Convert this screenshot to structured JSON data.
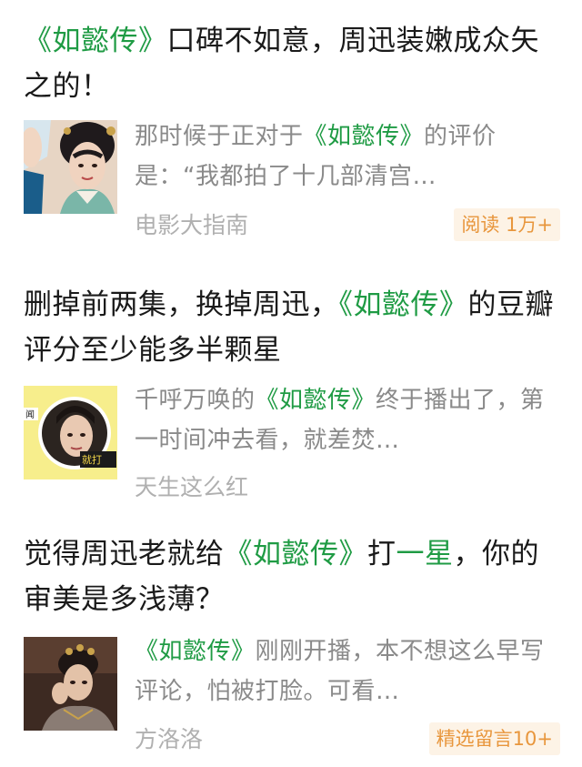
{
  "articles": [
    {
      "title": {
        "pre": "",
        "hl1": "《如懿传》",
        "mid": "口碑不如意，周迅装嫩成众矢之的！",
        "hl2": "",
        "post": ""
      },
      "summary": {
        "pre": "那时候于正对于",
        "hl": "《如懿传》",
        "post": "的评价是：“我都拍了十几部清宫…"
      },
      "source": "电影大指南",
      "badge": "阅读 1万+"
    },
    {
      "title": {
        "pre": "删掉前两集，换掉周迅，",
        "hl1": "《如懿传》",
        "mid": "的豆瓣评分至少能多半颗星",
        "hl2": "",
        "post": ""
      },
      "summary": {
        "pre": "千呼万唤的",
        "hl": "《如懿传》",
        "post": "终于播出了，第一时间冲去看，就差焚…"
      },
      "source": "天生这么红",
      "badge": ""
    },
    {
      "title": {
        "pre": "觉得周迅老就给",
        "hl1": "《如懿传》",
        "mid": "打",
        "hl2": "一星",
        "post": "，你的审美是多浅薄？"
      },
      "summary": {
        "pre": "",
        "hl": "《如懿传》",
        "post": "刚刚开播，本不想这么早写评论，怕被打脸。可看…"
      },
      "source": "方洛洛",
      "badge": "精选留言10+"
    }
  ],
  "colors": {
    "highlight": "#1f9b44",
    "title_text": "#1a1a1a",
    "summary_text": "#8a8a8a",
    "source_text": "#b0b0b0",
    "badge_bg": "#fdf3e6",
    "badge_text": "#e8963c"
  },
  "thumbnails": [
    "portrait-thumbnail-opera-costume",
    "portrait-thumbnail-yellow-background",
    "portrait-thumbnail-dark-palace"
  ]
}
